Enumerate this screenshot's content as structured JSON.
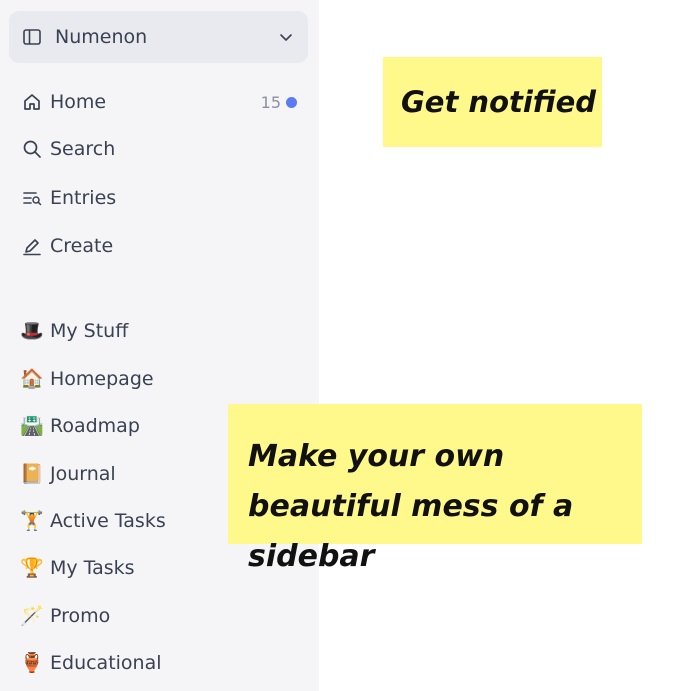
{
  "workspace": {
    "name": "Numenon"
  },
  "nav": [
    {
      "label": "Home",
      "icon": "home-icon",
      "badge_count": "15"
    },
    {
      "label": "Search",
      "icon": "search-icon"
    },
    {
      "label": "Entries",
      "icon": "entries-icon"
    },
    {
      "label": "Create",
      "icon": "edit-icon"
    }
  ],
  "sections": [
    {
      "label": "My Stuff",
      "emoji": "🎩",
      "icon": "top-hat-icon"
    },
    {
      "label": "Homepage",
      "emoji": "🏠",
      "icon": "house-icon"
    },
    {
      "label": "Roadmap",
      "emoji": "🛣️",
      "icon": "road-icon"
    },
    {
      "label": "Journal",
      "emoji": "📔",
      "icon": "notebook-icon"
    },
    {
      "label": "Active Tasks",
      "emoji": "🏋️",
      "icon": "weightlifter-icon"
    },
    {
      "label": "My Tasks",
      "emoji": "🏆",
      "icon": "trophy-icon"
    },
    {
      "label": "Promo",
      "emoji": "🪄",
      "icon": "magic-wand-icon"
    },
    {
      "label": "Educational",
      "emoji": "🏺",
      "icon": "amphora-icon"
    }
  ],
  "notes": [
    {
      "text": "Get notified"
    },
    {
      "text": "Make your own beautiful mess of a sidebar"
    }
  ],
  "colors": {
    "sidebar_bg": "#f5f5f7",
    "note_bg": "#fff88a",
    "badge_dot": "#5b7cf0"
  }
}
